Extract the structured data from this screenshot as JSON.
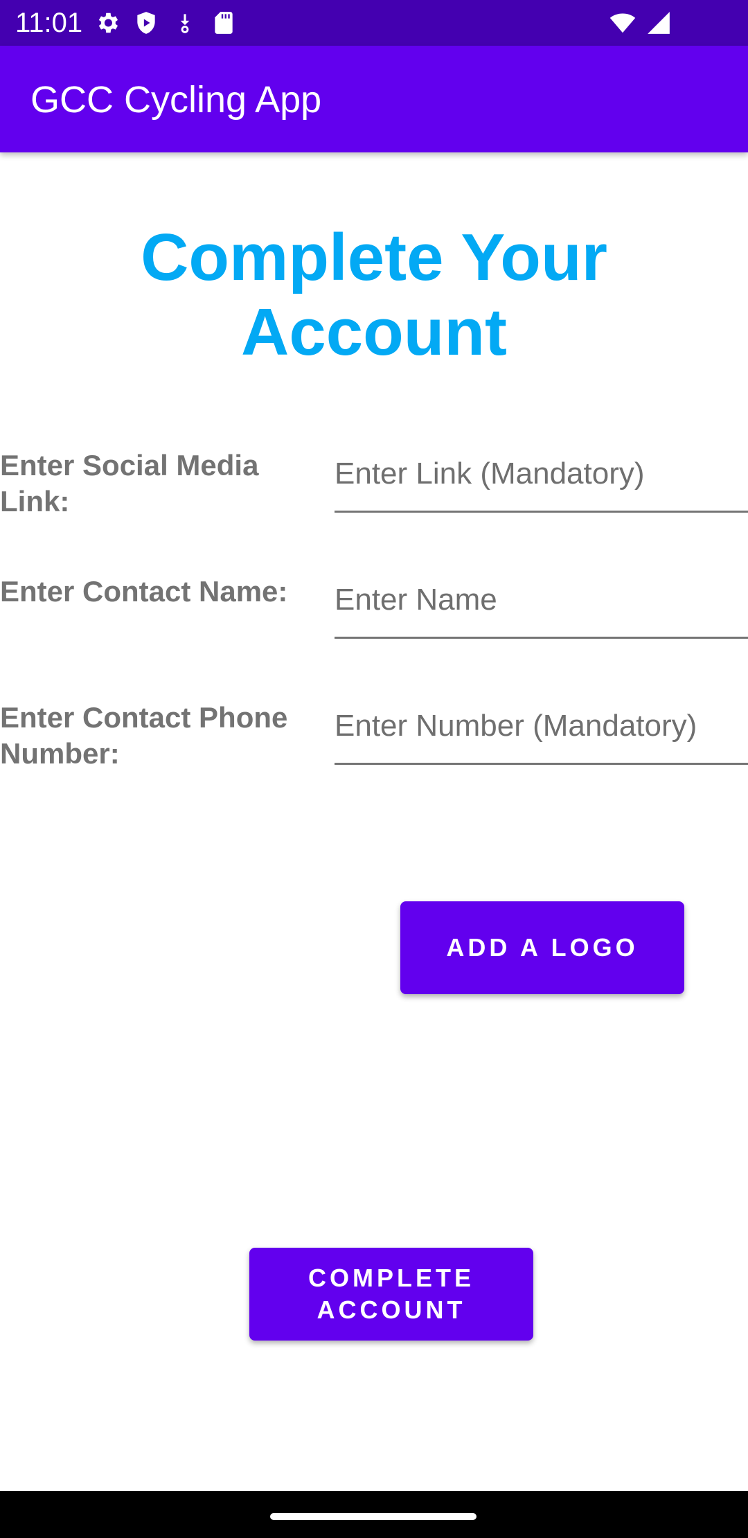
{
  "status_bar": {
    "time": "11:01",
    "left_icons": [
      "gear-icon",
      "shield-icon",
      "download-icon",
      "sd-card-icon"
    ],
    "right_icons": [
      "wifi-icon",
      "signal-icon"
    ],
    "color": "#4400b0"
  },
  "app_bar": {
    "title": "GCC Cycling App",
    "color": "#6200ee"
  },
  "page": {
    "heading": "Complete Your Account",
    "heading_color": "#03a9f4"
  },
  "form": {
    "social": {
      "label": "Enter Social Media Link:",
      "placeholder": "Enter Link (Mandatory)"
    },
    "name": {
      "label": "Enter Contact Name:",
      "placeholder": "Enter Name"
    },
    "phone": {
      "label": "Enter Contact Phone Number:",
      "placeholder": "Enter Number (Mandatory)"
    }
  },
  "buttons": {
    "add_logo": "ADD A LOGO",
    "complete_account": "COMPLETE ACCOUNT"
  }
}
